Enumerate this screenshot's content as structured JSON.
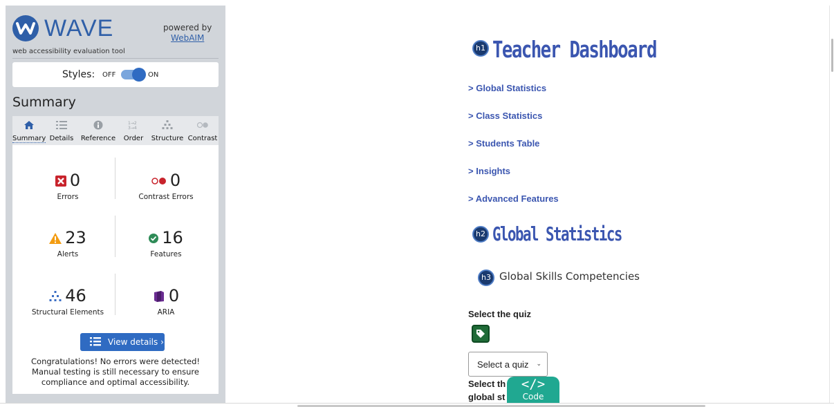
{
  "sidebar": {
    "logo_text": "WAVE",
    "logo_subtitle": "web accessibility evaluation tool",
    "powered_by": "powered by",
    "powered_link": "WebAIM",
    "styles_label": "Styles:",
    "styles_off": "OFF",
    "styles_on": "ON",
    "summary_heading": "Summary",
    "tabs": [
      {
        "label": "Summary",
        "icon": "home-icon",
        "active": true
      },
      {
        "label": "Details",
        "icon": "list-icon",
        "active": false
      },
      {
        "label": "Reference",
        "icon": "info-icon",
        "active": false
      },
      {
        "label": "Order",
        "icon": "order-icon",
        "active": false
      },
      {
        "label": "Structure",
        "icon": "structure-icon",
        "active": false
      },
      {
        "label": "Contrast",
        "icon": "contrast-icon",
        "active": false
      }
    ],
    "stats": {
      "errors": {
        "value": "0",
        "label": "Errors"
      },
      "contrast_errors": {
        "value": "0",
        "label": "Contrast Errors"
      },
      "alerts": {
        "value": "23",
        "label": "Alerts"
      },
      "features": {
        "value": "16",
        "label": "Features"
      },
      "structural": {
        "value": "46",
        "label": "Structural Elements"
      },
      "aria": {
        "value": "0",
        "label": "ARIA"
      }
    },
    "view_details_label": "View details ›",
    "congrats": "Congratulations! No errors were detected! Manual testing is still necessary to ensure compliance and optimal accessibility."
  },
  "main": {
    "h1_badge": "h1",
    "h1": "Teacher Dashboard",
    "links": [
      "> Global Statistics",
      "> Class Statistics",
      "> Students Table",
      "> Insights",
      "> Advanced Features"
    ],
    "h2_badge": "h2",
    "h2": "Global Statistics",
    "h3_badge": "h3",
    "h3": "Global Skills Competencies",
    "select_label": "Select the quiz",
    "select_value": "Select a quiz",
    "cut_line1": "Select th",
    "cut_line2": "global st",
    "code_icon": "</>",
    "code_label": "Code"
  },
  "colors": {
    "accent": "#2f6bc2",
    "heading": "#3b56b0",
    "sidebar_bg": "#d1d5da",
    "code_button": "#20a891"
  }
}
